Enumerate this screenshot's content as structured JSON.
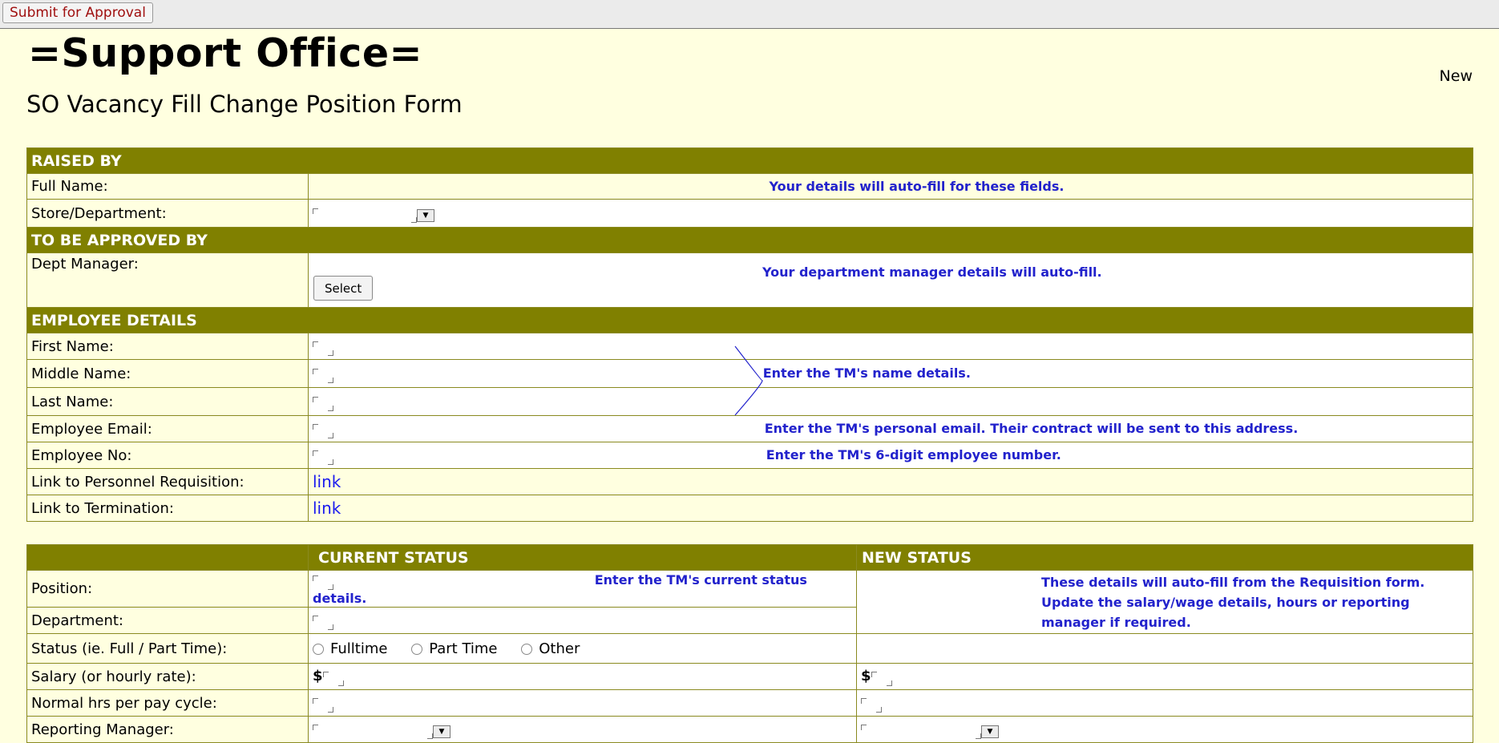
{
  "toolbar": {
    "submit_label": "Submit for Approval"
  },
  "header": {
    "brand": "=Support Office=",
    "form_title": "SO Vacancy Fill Change Position Form",
    "status": "New"
  },
  "sections": {
    "raised_by": "RAISED BY",
    "approved_by": "TO BE APPROVED BY",
    "employee_details": "EMPLOYEE DETAILS"
  },
  "raised_by": {
    "full_name_label": "Full Name:",
    "store_dept_label": "Store/Department:",
    "note": "Your details will auto-fill for these fields."
  },
  "approved_by": {
    "dept_manager_label": "Dept Manager:",
    "select_label": "Select",
    "note": "Your department manager details will auto-fill."
  },
  "employee": {
    "first_name_label": "First Name:",
    "middle_name_label": "Middle Name:",
    "last_name_label": "Last Name:",
    "name_note": "Enter the TM's name details.",
    "email_label": "Employee Email:",
    "email_note": "Enter the TM's personal email. Their contract will be sent to this address.",
    "no_label": "Employee No:",
    "no_note": "Enter the TM's 6-digit employee number.",
    "link_requisition_label": "Link to Personnel Requisition:",
    "link_termination_label": "Link to Termination:",
    "link_text": "link"
  },
  "status_table": {
    "current_header": "CURRENT STATUS",
    "new_header": "NEW STATUS",
    "position_label": "Position:",
    "department_label": "Department:",
    "status_label": "Status (ie. Full / Part Time):",
    "salary_label": "Salary (or hourly rate):",
    "hours_label": "Normal hrs per pay cycle:",
    "manager_label": "Reporting Manager:",
    "current_note": "Enter the TM's current status details.",
    "new_note": "These details will auto-fill from the Requisition form. Update the salary/wage details, hours or reporting manager if required.",
    "radio_options": [
      "Fulltime",
      "Part Time",
      "Other"
    ],
    "currency": "$"
  },
  "colors": {
    "section_header": "#808000",
    "page_background": "#ffffe0",
    "note_text": "#2222cc",
    "link": "#1a1aee"
  }
}
